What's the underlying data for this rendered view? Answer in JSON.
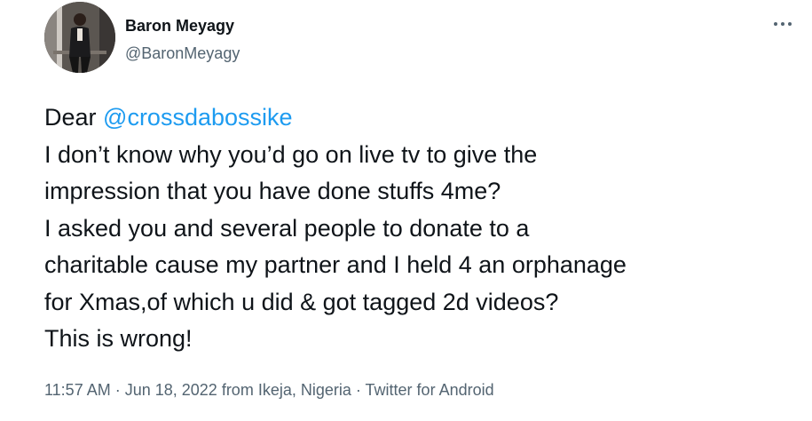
{
  "author": {
    "name": "Baron Meyagy",
    "handle": "@BaronMeyagy"
  },
  "tweet": {
    "greeting": "Dear ",
    "mention": "@crossdabossike",
    "lines": [
      "I don’t know why you’d go on live tv to give the",
      "impression that you have done stuffs 4me?",
      "I asked you and several people to donate to a",
      "charitable cause my partner and I held 4 an orphanage",
      "for Xmas,of which u did & got tagged 2d videos?",
      "This is wrong!"
    ]
  },
  "meta": {
    "time": "11:57 AM",
    "separator": " · ",
    "date": "Jun 18, 2022",
    "location": " from Ikeja, Nigeria",
    "source": "Twitter for Android"
  },
  "icons": {
    "more": "more-horizontal-icon"
  },
  "colors": {
    "text": "#0f1419",
    "secondary": "#536471",
    "link": "#1d9bf0"
  }
}
